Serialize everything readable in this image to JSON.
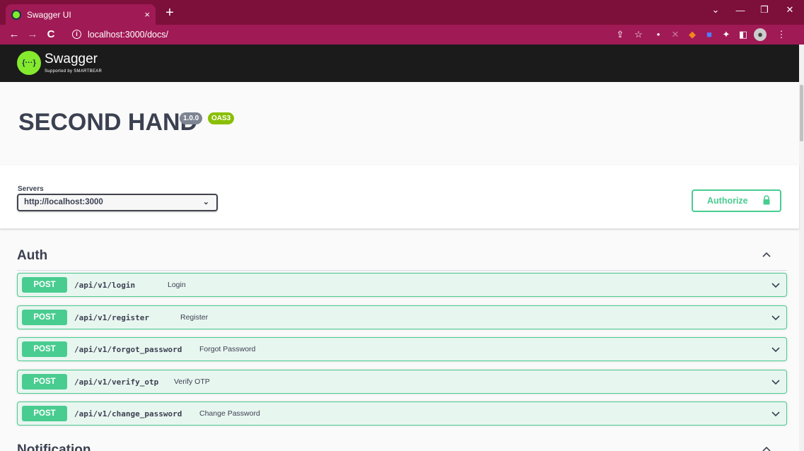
{
  "browser": {
    "tab_title": "Swagger UI",
    "tab_close": "×",
    "new_tab": "+",
    "url": "localhost:3000/docs/",
    "controls": {
      "minimize": "—",
      "restore": "❐",
      "close": "✕",
      "tablist": "⌄"
    }
  },
  "swagger": {
    "brand": "Swagger",
    "brand_sub": "Supported by SMARTBEAR",
    "logo_glyph": "{···}"
  },
  "info": {
    "title": "SECOND HAND",
    "version": "1.0.0",
    "oas": "OAS3"
  },
  "servers": {
    "label": "Servers",
    "selected": "http://localhost:3000",
    "authorize_label": "Authorize"
  },
  "tags": [
    {
      "name": "Auth",
      "operations": [
        {
          "method": "POST",
          "path": "/api/v1/login",
          "summary": "Login"
        },
        {
          "method": "POST",
          "path": "/api/v1/register",
          "summary": "Register"
        },
        {
          "method": "POST",
          "path": "/api/v1/forgot_password",
          "summary": "Forgot Password"
        },
        {
          "method": "POST",
          "path": "/api/v1/verify_otp",
          "summary": "Verify OTP"
        },
        {
          "method": "POST",
          "path": "/api/v1/change_password",
          "summary": "Change Password"
        }
      ]
    },
    {
      "name": "Notification",
      "operations": []
    }
  ],
  "colors": {
    "post_green": "#49cc90",
    "post_bg": "#e8f6f0",
    "browser_theme": "#7d0f3b",
    "oas_green": "#89bf04"
  }
}
